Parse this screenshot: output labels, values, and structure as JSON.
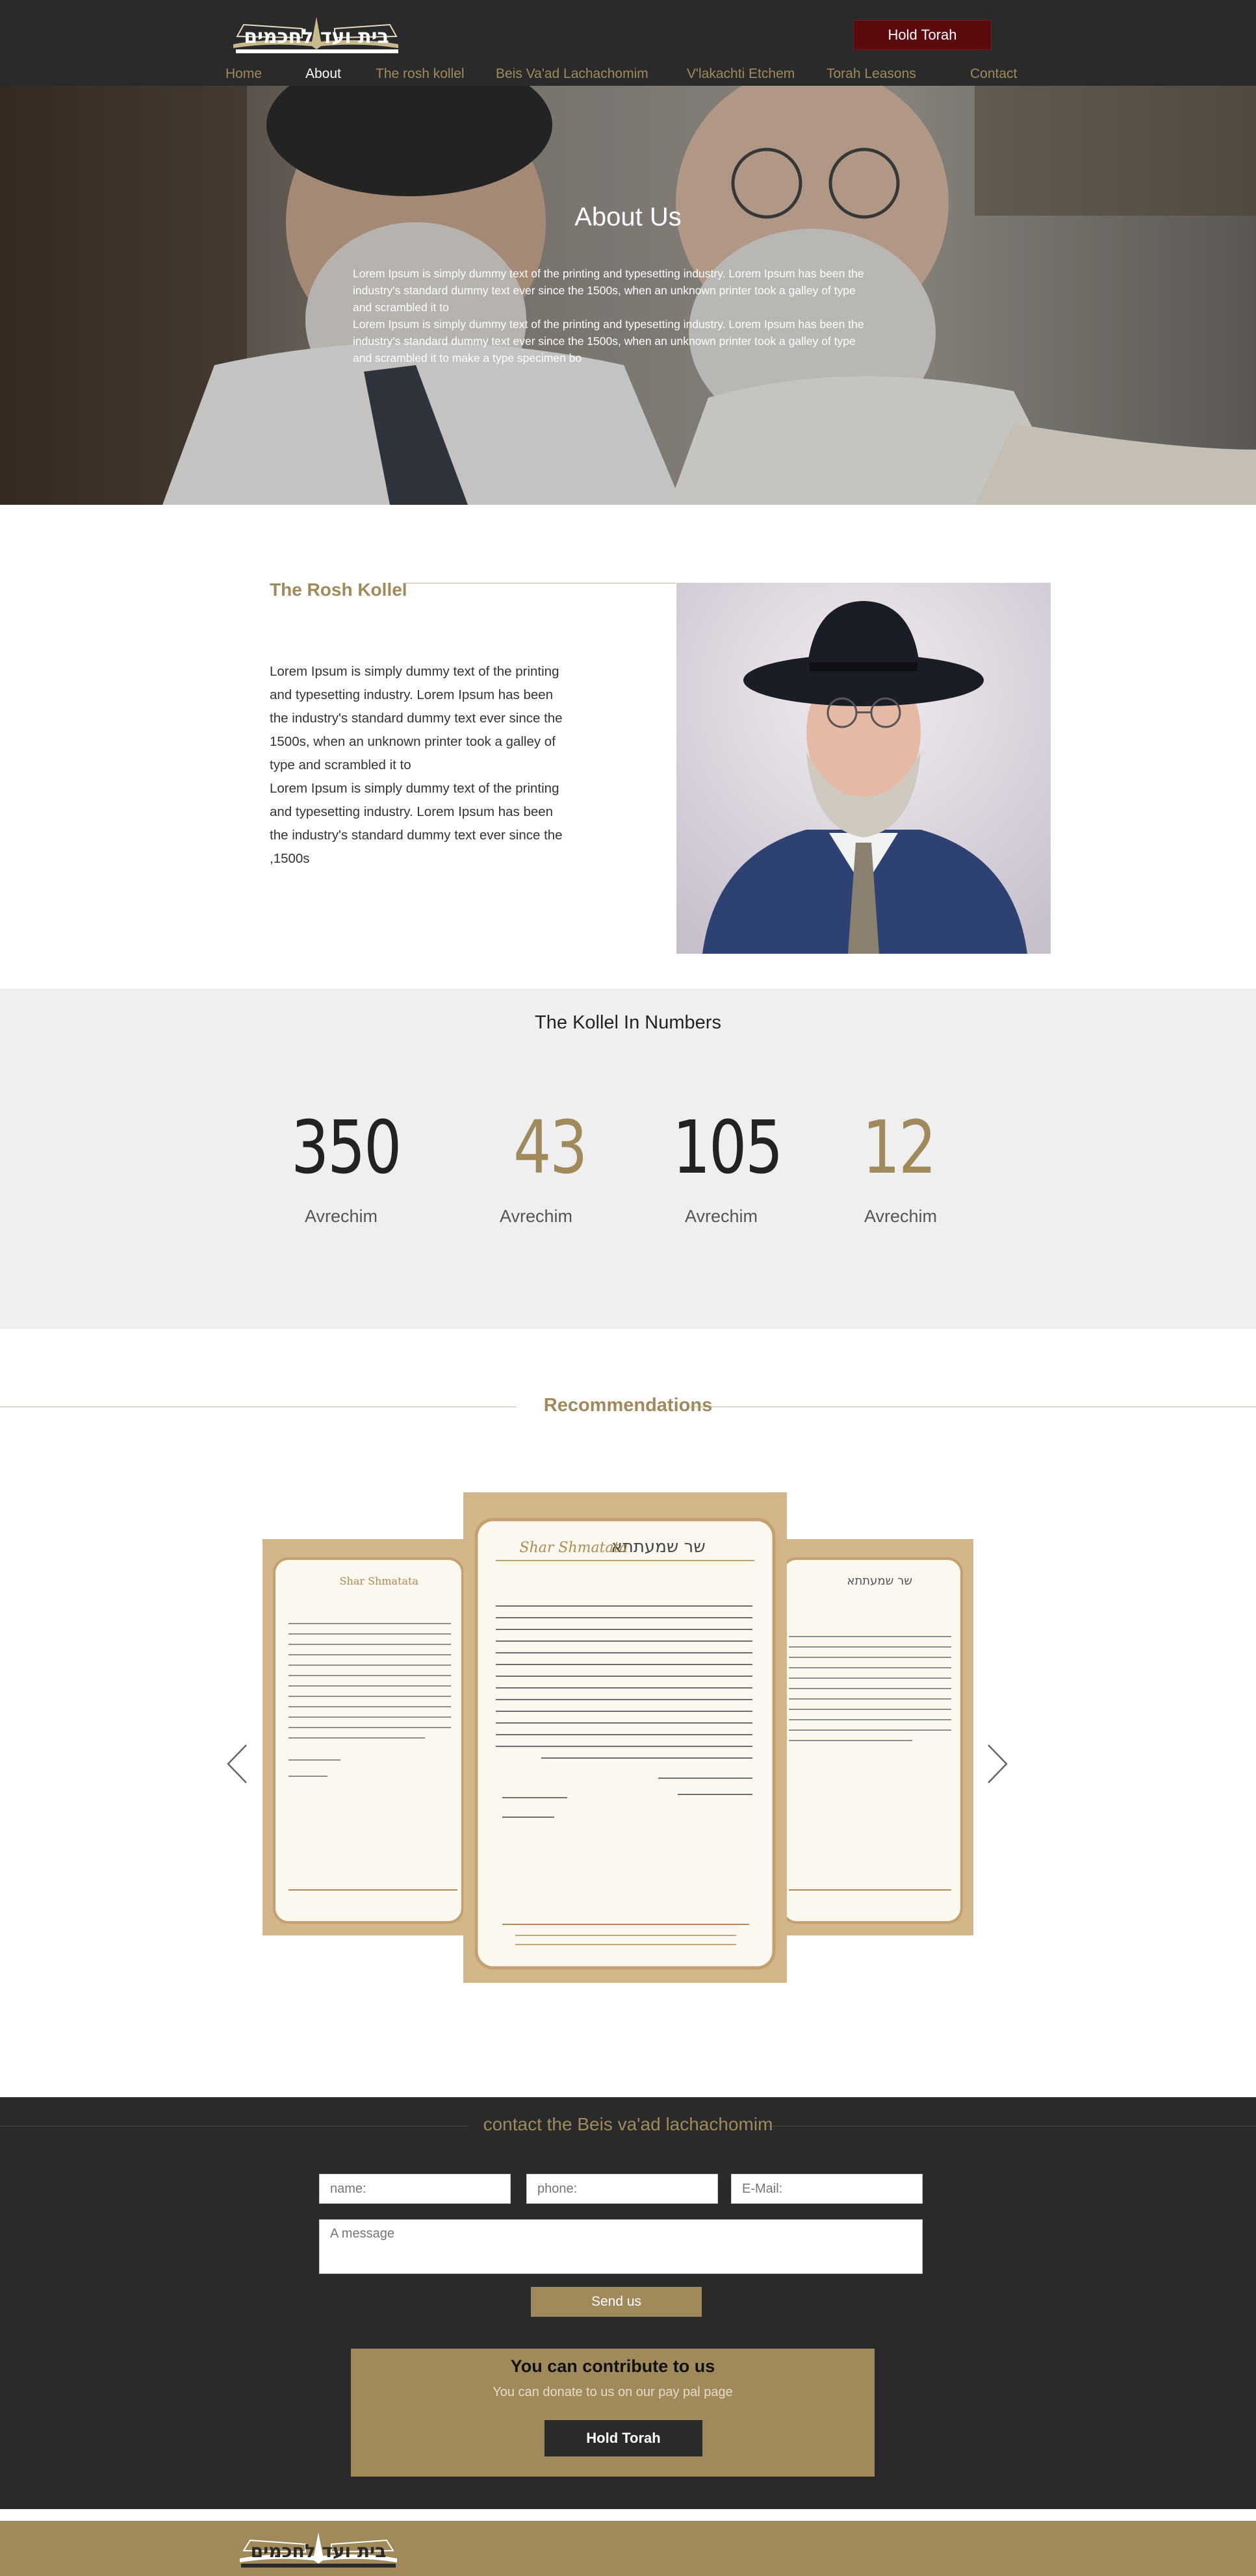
{
  "header": {
    "logo_text": "בית ועד לחכמים",
    "hold_torah_label": "Hold  Torah",
    "nav": [
      {
        "label": "Home"
      },
      {
        "label": "About"
      },
      {
        "label": "The rosh kollel"
      },
      {
        "label": "Beis Va'ad Lachachomim"
      },
      {
        "label": "V'lakachti Etchem"
      },
      {
        "label": "Torah Leasons"
      },
      {
        "label": "Contact"
      }
    ]
  },
  "hero": {
    "title": "About Us",
    "paragraph1": "Lorem Ipsum is simply dummy text of the printing and typesetting industry. Lorem Ipsum has been the industry's standard dummy text ever since the 1500s, when an unknown printer took a galley of type and scrambled it to",
    "paragraph2": "Lorem Ipsum is simply dummy text of the printing and typesetting industry. Lorem Ipsum has been the industry's standard dummy text ever since the 1500s, when an unknown printer took a galley of type and scrambled it to make a type specimen bo"
  },
  "rosh_kollel": {
    "title": "The Rosh Kollel",
    "paragraph1": "Lorem Ipsum is simply dummy text of the printing and typesetting industry. Lorem Ipsum has been the industry's standard dummy text ever since the 1500s, when an unknown printer took a galley of type and scrambled it to",
    "paragraph2": "Lorem Ipsum is simply dummy text of the printing and typesetting industry. Lorem Ipsum has been the industry's standard dummy text ever since the ,1500s"
  },
  "numbers": {
    "title": "The Kollel In Numbers",
    "items": [
      {
        "value": "350",
        "label": "Avrechim",
        "color": "#222222"
      },
      {
        "value": "43",
        "label": "Avrechim",
        "color": "#a08a5c"
      },
      {
        "value": "105",
        "label": "Avrechim",
        "color": "#222222"
      },
      {
        "value": "12",
        "label": "Avrechim",
        "color": "#a08a5c"
      }
    ]
  },
  "recommendations": {
    "title": "Recommendations",
    "letterhead_hebrew": "שר שמעתתא",
    "letterhead_latin": "Shar Shmatata"
  },
  "contact": {
    "title": "contact the Beis va'ad lachachomim",
    "name_placeholder": "name:",
    "phone_placeholder": "phone:",
    "email_placeholder": "E-Mail:",
    "message_placeholder": "A message",
    "send_label": "Send us",
    "donate_title": "You can contribute to us",
    "donate_sub": "You can donate to us on our pay pal page",
    "donate_button": "Hold Torah"
  },
  "colors": {
    "gold": "#a08a5c",
    "dark": "#2a2a2a",
    "maroon": "#5c0a0e"
  }
}
